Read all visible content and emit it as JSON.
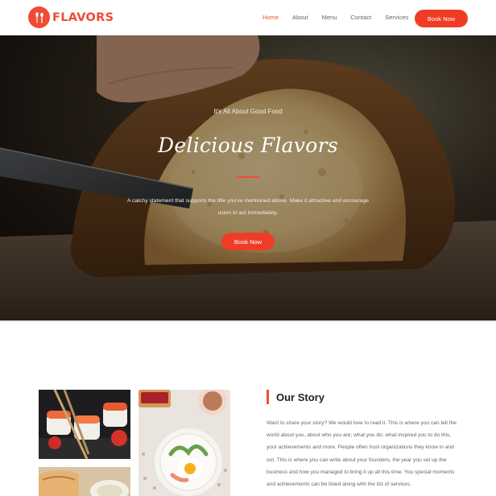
{
  "header": {
    "logo_text": "FLAVORS",
    "nav": [
      "Home",
      "About",
      "Menu",
      "Contact",
      "Services"
    ],
    "active_nav": "Home",
    "book_button": "Book Now"
  },
  "hero": {
    "kicker": "It's All About Good Food",
    "title": "Delicious Flavors",
    "description": "A catchy statement that supports the title you've mentioned above. Make it attractive and encourage users to act immediately.",
    "book_button": "Book Now"
  },
  "story": {
    "heading": "Our Story",
    "text": "Want to share your story? We would love to read it. This is where you can tell the world about you, about who you are; what you do; what inspired you to do this, your achievements and more. People often trust organizations they know in and out. This is where you can write about your founders, the year you set up the business and how you managed to bring it up all this time. You special moments and achievements can be listed along with the list of services."
  },
  "colors": {
    "accent": "#ef4b35",
    "button": "#ef3d25"
  },
  "icons": {
    "logo": "fork-spoon-icon"
  }
}
